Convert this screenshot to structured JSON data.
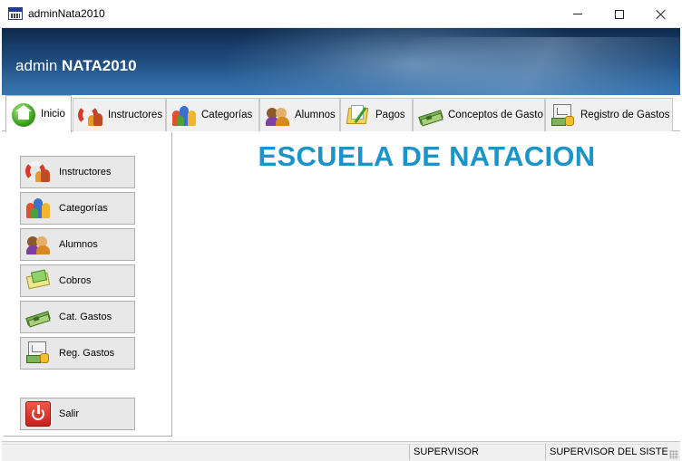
{
  "window": {
    "title": "adminNata2010",
    "icon": "app-window-icon",
    "controls": [
      "minimize",
      "maximize",
      "close"
    ]
  },
  "banner": {
    "title_regular": "admin",
    "title_bold": "NATA2010"
  },
  "tabs": [
    {
      "label": "Inicio",
      "icon": "home-icon",
      "active": true
    },
    {
      "label": "Instructores",
      "icon": "lifebuoy-icon",
      "active": false
    },
    {
      "label": "Categorías",
      "icon": "people-group-icon",
      "active": false
    },
    {
      "label": "Alumnos",
      "icon": "students-icon",
      "active": false
    },
    {
      "label": "Pagos",
      "icon": "payments-icon",
      "active": false
    },
    {
      "label": "Conceptos de Gasto",
      "icon": "money-icon",
      "active": false
    },
    {
      "label": "Registro de Gastos",
      "icon": "expense-register-icon",
      "active": false
    }
  ],
  "sidebar": {
    "buttons": [
      {
        "label": "Instructores",
        "icon": "lifebuoy-icon"
      },
      {
        "label": "Categorías",
        "icon": "people-group-icon"
      },
      {
        "label": "Alumnos",
        "icon": "students-icon"
      },
      {
        "label": "Cobros",
        "icon": "cash-icon"
      },
      {
        "label": "Cat. Gastos",
        "icon": "money-icon"
      },
      {
        "label": "Reg. Gastos",
        "icon": "expense-register-icon"
      },
      {
        "label": "Salir",
        "icon": "power-icon"
      }
    ]
  },
  "main": {
    "heading": "ESCUELA DE NATACION",
    "heading_color": "#1b95c9"
  },
  "statusbar": {
    "user": "SUPERVISOR",
    "role": "SUPERVISOR DEL SISTEM"
  }
}
